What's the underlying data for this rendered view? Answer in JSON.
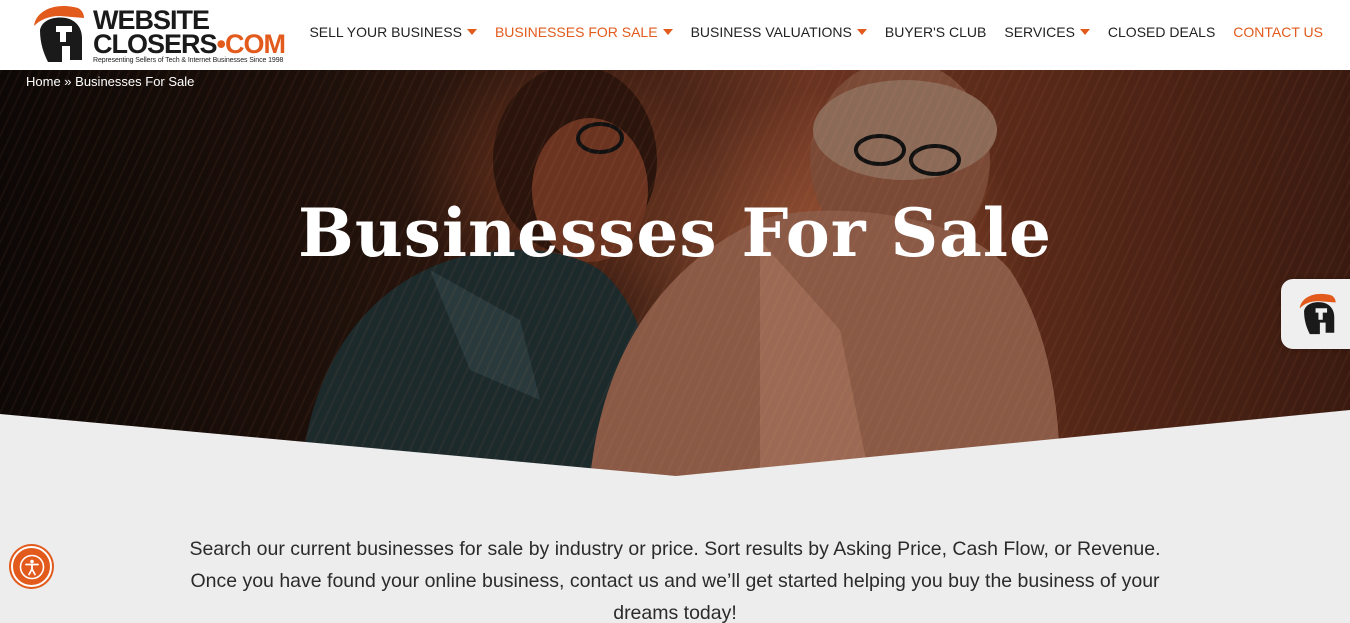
{
  "logo": {
    "word1": "WEBSITE",
    "word2_main": "CLOSERS",
    "word2_dot": "•",
    "word2_com": "COM",
    "tagline": "Representing Sellers of Tech & Internet Businesses Since 1998"
  },
  "nav": {
    "items": [
      {
        "label": "SELL YOUR BUSINESS",
        "has_dropdown": true
      },
      {
        "label": "BUSINESSES FOR SALE",
        "has_dropdown": true,
        "active": true
      },
      {
        "label": "BUSINESS VALUATIONS",
        "has_dropdown": true
      },
      {
        "label": "BUYER'S CLUB",
        "has_dropdown": false
      },
      {
        "label": "SERVICES",
        "has_dropdown": true
      },
      {
        "label": "CLOSED DEALS",
        "has_dropdown": false
      },
      {
        "label": "CONTACT US",
        "has_dropdown": false
      }
    ]
  },
  "breadcrumb": {
    "home": "Home",
    "separator": " » ",
    "current": "Businesses For Sale"
  },
  "hero": {
    "title": "Businesses For Sale"
  },
  "intro": {
    "text": "Search our current businesses for sale by industry or price.  Sort results by Asking Price, Cash Flow, or Revenue. Once you have found your online business, contact us and we’ll get started helping you buy the business of your dreams today!"
  },
  "colors": {
    "accent": "#e25a1c",
    "nav_text": "#222222",
    "page_bg": "#ededed"
  },
  "icons": {
    "logo": "spartan-helmet-icon",
    "side_tab": "spartan-helmet-icon",
    "accessibility": "accessibility-icon",
    "dropdown": "caret-down-icon"
  }
}
